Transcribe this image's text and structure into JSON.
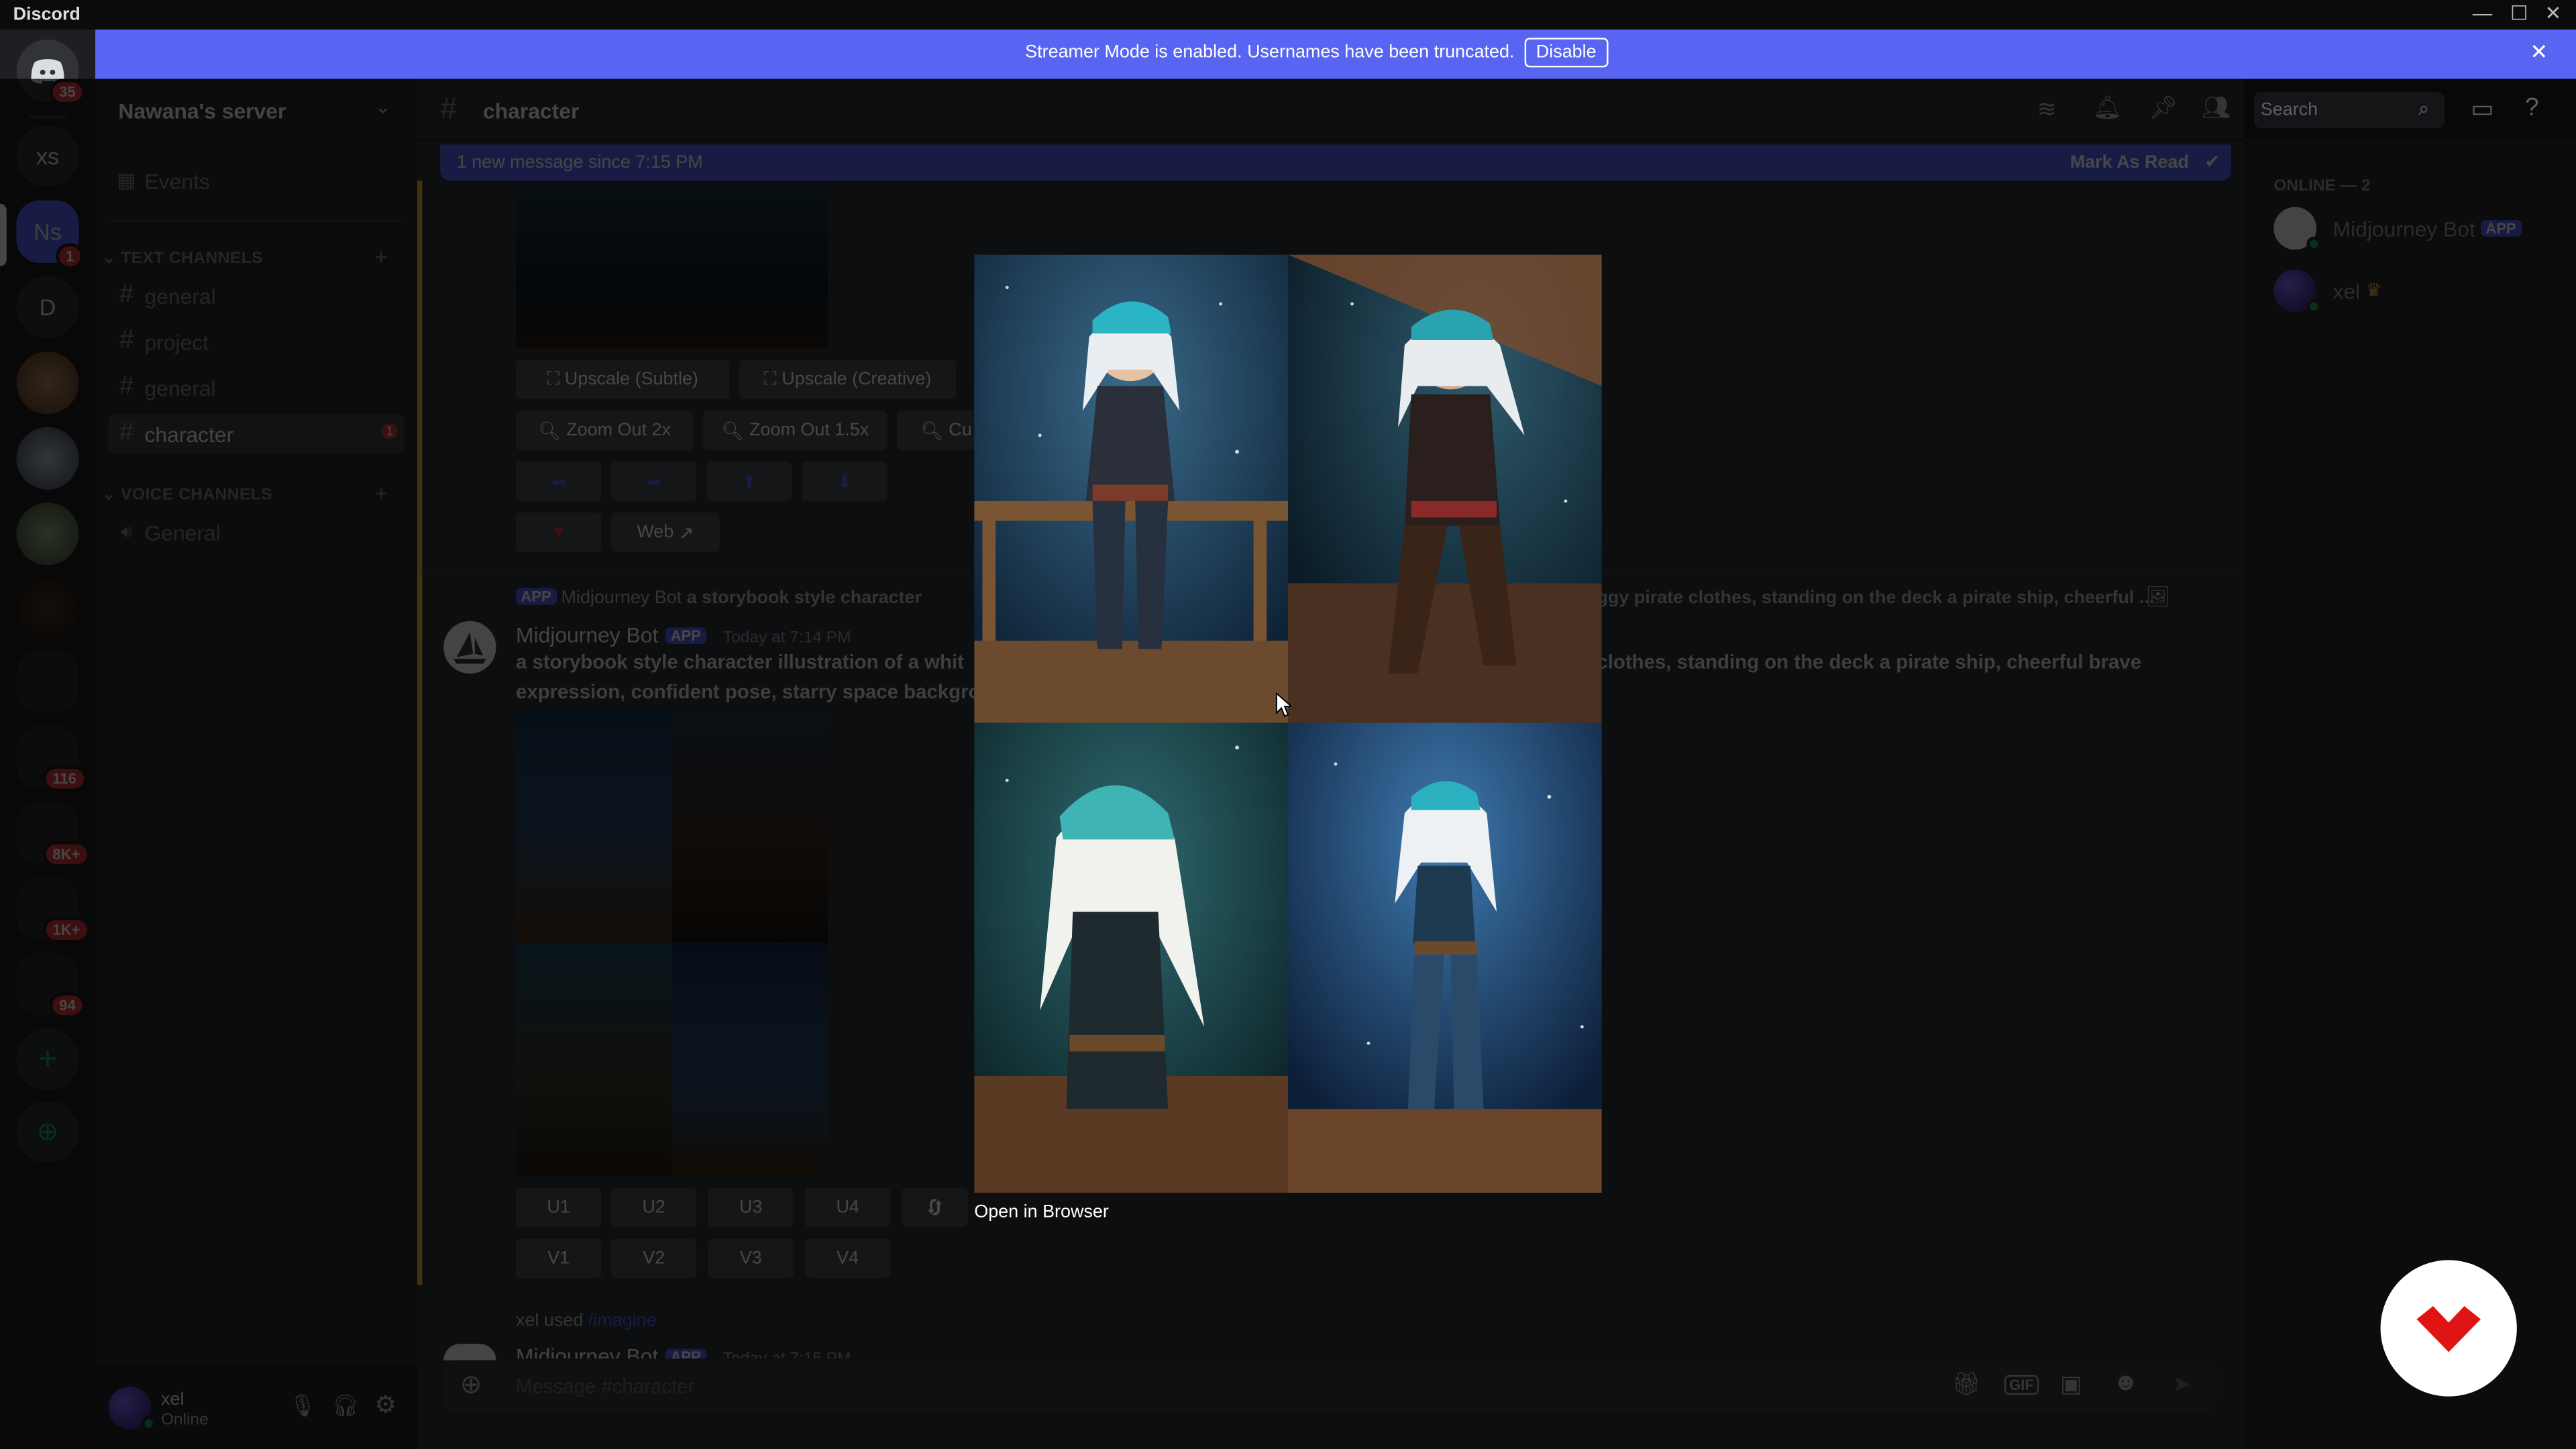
{
  "window": {
    "title": "Discord"
  },
  "rail": {
    "home_badge": "35",
    "servers": [
      {
        "label": "xs",
        "badge": ""
      },
      {
        "label": "Ns",
        "badge": "1"
      },
      {
        "label": "D",
        "badge": ""
      }
    ],
    "badges": [
      "116",
      "8K+",
      "1K+",
      "94"
    ]
  },
  "banner": {
    "text": "Streamer Mode is enabled. Usernames have been truncated.",
    "button": "Disable"
  },
  "sidebar": {
    "server_name": "Nawana's server",
    "events_label": "Events",
    "text_category": "TEXT CHANNELS",
    "text_channels": [
      {
        "name": "general",
        "badge": ""
      },
      {
        "name": "project",
        "badge": ""
      },
      {
        "name": "general",
        "badge": ""
      },
      {
        "name": "character",
        "badge": "1"
      }
    ],
    "voice_category": "VOICE CHANNELS",
    "voice_channels": [
      {
        "name": "General"
      }
    ],
    "user": {
      "name": "xel",
      "status": "Online"
    }
  },
  "header": {
    "channel": "character",
    "search_placeholder": "Search"
  },
  "new_messages": {
    "text": "1 new message since 7:15 PM",
    "mark_read": "Mark As Read"
  },
  "buttons_top": {
    "upscale_subtle": "Upscale (Subtle)",
    "upscale_creative": "Upscale (Creative)",
    "zoom2": "Zoom Out 2x",
    "zoom15": "Zoom Out 1.5x",
    "custom": "Cu",
    "web": "Web"
  },
  "message": {
    "reply_author": "Midjourney Bot",
    "reply_text": "a storybook style character",
    "reply_text_right": "ggy pirate clothes, standing on the deck a pirate ship, cheerful ...",
    "author": "Midjourney Bot",
    "app_tag": "APP",
    "time": "Today at 7:14 PM",
    "prompt_left": "a storybook style character illustration of a whit",
    "prompt_left2": "expression, confident pose, starry space backgro",
    "prompt_right": "clothes, standing on the deck a pirate ship, cheerful brave"
  },
  "actions": {
    "u": [
      "U1",
      "U2",
      "U3",
      "U4"
    ],
    "v": [
      "V1",
      "V2",
      "V3",
      "V4"
    ]
  },
  "lightbox": {
    "open_in_browser": "Open in Browser"
  },
  "next_message": {
    "used": "xel used",
    "command": "/imagine",
    "author": "Midjourney Bot",
    "app_tag": "APP",
    "time": "Today at 7:15 PM"
  },
  "composer": {
    "placeholder": "Message #character"
  },
  "member_list": {
    "online_header": "ONLINE — 2",
    "members": [
      {
        "name": "Midjourney Bot",
        "tag": "APP"
      },
      {
        "name": "xel",
        "tag": ""
      }
    ]
  },
  "colors": {
    "blurple": "#5865f2",
    "red": "#da373c",
    "green": "#23a55a",
    "bg": "#313338"
  }
}
